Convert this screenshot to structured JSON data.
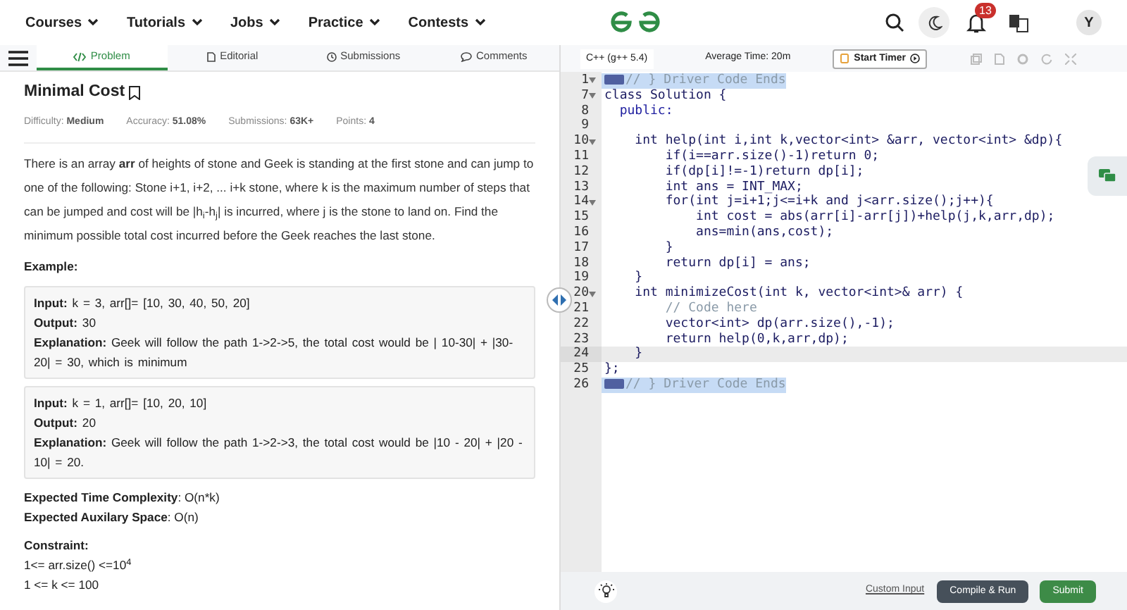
{
  "nav": {
    "menus": [
      "Courses",
      "Tutorials",
      "Jobs",
      "Practice",
      "Contests"
    ],
    "notifications": "13",
    "avatar": "Y"
  },
  "tabs": [
    {
      "label": "Problem",
      "selected": true
    },
    {
      "label": "Editorial",
      "selected": false
    },
    {
      "label": "Submissions",
      "selected": false
    },
    {
      "label": "Comments",
      "selected": false
    }
  ],
  "problem": {
    "title": "Minimal Cost",
    "meta": [
      {
        "label": "Difficulty:",
        "value": "Medium"
      },
      {
        "label": "Accuracy:",
        "value": "51.08%"
      },
      {
        "label": "Submissions:",
        "value": "63K+"
      },
      {
        "label": "Points:",
        "value": "4"
      }
    ],
    "description": "There is an array **arr** of heights of stone and Geek is standing at the first stone and can jump to one of the following: Stone i+1, i+2, ... i+k stone, where k is the maximum number of steps that can be jumped and cost will be |h$_{i}$-h$_{j}$| is incurred, where j is the stone to land on. Find the minimum possible total cost incurred before the Geek reaches the last stone.",
    "example_heading": "Example:",
    "examples": [
      [
        "**Input:** k = 3, arr[]= [10, 30, 40, 50, 20]",
        "**Output:** 30",
        "**Explanation:** Geek will follow the path 1->2->5, the total cost would be | 10-30| + |30-20| = 30, which is minimum"
      ],
      [
        "**Input:** k = 1, arr[]= [10, 20, 10]",
        "**Output:** 20",
        "**Explanation:** Geek will follow the path 1->2->3, the total cost would be |10 - 20| + |20 - 10| = 20."
      ]
    ],
    "complexity": [
      "**Expected Time Complexity**: O(n*k)",
      "**Expected Auxilary Space**: O(n)"
    ],
    "constraint_heading": "Constraint:",
    "constraints": [
      "1<= arr.size() <=10$^{4}$",
      "1 <= k <= 100"
    ]
  },
  "editor": {
    "language": "C++ (g++ 5.4)",
    "average_time": "Average Time: 20m",
    "timer": "Start Timer",
    "lines": [
      {
        "number": "1",
        "text": "// } Driver Code Ends",
        "kind": "comment",
        "foldable": true,
        "folded": true,
        "selected": true,
        "current": false
      },
      {
        "number": "7",
        "text": "class Solution {",
        "kind": "code",
        "foldable": true,
        "folded": false,
        "selected": false,
        "current": false
      },
      {
        "number": "8",
        "text": "  public:",
        "kind": "keyword",
        "foldable": false,
        "folded": false,
        "selected": false,
        "current": false
      },
      {
        "number": "9",
        "foldable": false,
        "folded": false,
        "selected": false,
        "current": false
      },
      {
        "number": "10",
        "text": "    int help(int i,int k,vector<int> &arr, vector<int> &dp){",
        "kind": "code",
        "foldable": true,
        "folded": false,
        "selected": false,
        "current": false
      },
      {
        "number": "11",
        "text": "        if(i==arr.size()-1)return 0;",
        "kind": "code",
        "foldable": false,
        "folded": false,
        "selected": false,
        "current": false
      },
      {
        "number": "12",
        "text": "        if(dp[i]!=-1)return dp[i];",
        "kind": "code",
        "foldable": false,
        "folded": false,
        "selected": false,
        "current": false
      },
      {
        "number": "13",
        "text": "        int ans = INT_MAX;",
        "kind": "code",
        "foldable": false,
        "folded": false,
        "selected": false,
        "current": false
      },
      {
        "number": "14",
        "text": "        for(int j=i+1;j<=i+k and j<arr.size();j++){",
        "kind": "code",
        "foldable": true,
        "folded": false,
        "selected": false,
        "current": false
      },
      {
        "number": "15",
        "text": "            int cost = abs(arr[i]-arr[j])+help(j,k,arr,dp);",
        "kind": "code",
        "foldable": false,
        "folded": false,
        "selected": false,
        "current": false
      },
      {
        "number": "16",
        "text": "            ans=min(ans,cost);",
        "kind": "code",
        "foldable": false,
        "folded": false,
        "selected": false,
        "current": false
      },
      {
        "number": "17",
        "text": "        }",
        "kind": "code",
        "foldable": false,
        "folded": false,
        "selected": false,
        "current": false
      },
      {
        "number": "18",
        "text": "        return dp[i] = ans;",
        "kind": "code",
        "foldable": false,
        "folded": false,
        "selected": false,
        "current": false
      },
      {
        "number": "19",
        "text": "    }",
        "kind": "code",
        "foldable": false,
        "folded": false,
        "selected": false,
        "current": false
      },
      {
        "number": "20",
        "text": "    int minimizeCost(int k, vector<int>& arr) {",
        "kind": "code",
        "foldable": true,
        "folded": false,
        "selected": false,
        "current": false
      },
      {
        "number": "21",
        "text": "        // Code here",
        "kind": "comment",
        "foldable": false,
        "folded": false,
        "selected": false,
        "current": false
      },
      {
        "number": "22",
        "text": "        vector<int> dp(arr.size(),-1);",
        "kind": "code",
        "foldable": false,
        "folded": false,
        "selected": false,
        "current": false
      },
      {
        "number": "23",
        "text": "        return help(0,k,arr,dp);",
        "kind": "code",
        "foldable": false,
        "folded": false,
        "selected": false,
        "current": false
      },
      {
        "number": "24",
        "text": "    }",
        "kind": "code",
        "foldable": false,
        "folded": false,
        "selected": false,
        "current": true
      },
      {
        "number": "25",
        "text": "};",
        "kind": "code",
        "foldable": false,
        "folded": false,
        "selected": false,
        "current": false
      },
      {
        "number": "26",
        "text": "// } Driver Code Ends",
        "kind": "comment",
        "foldable": false,
        "folded": true,
        "selected": true,
        "current": false
      }
    ],
    "custom_input": "Custom Input",
    "compile": "Compile & Run",
    "submit": "Submit"
  }
}
